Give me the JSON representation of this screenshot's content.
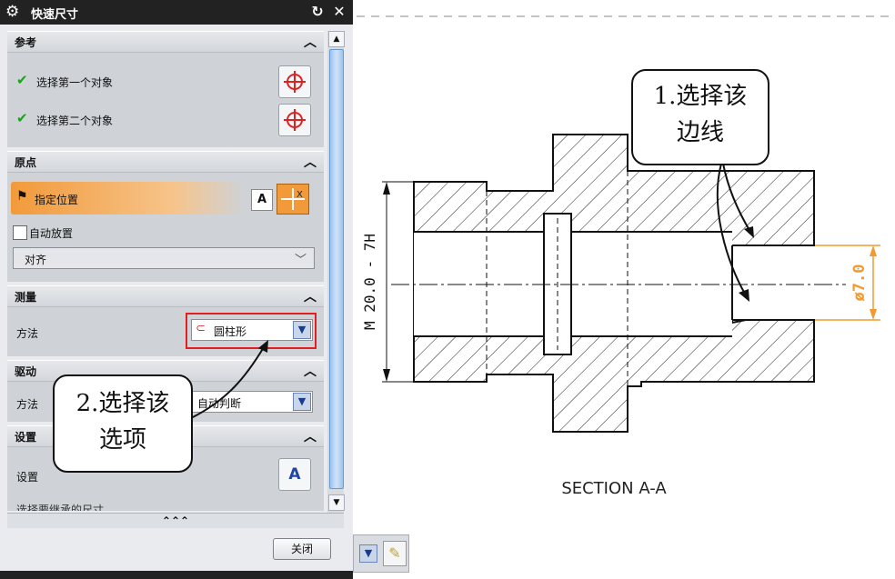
{
  "window": {
    "title": "快速尺寸"
  },
  "sections": {
    "reference": {
      "label": "参考",
      "item1": "选择第一个对象",
      "item2": "选择第二个对象"
    },
    "origin": {
      "label": "原点",
      "specify": "指定位置",
      "auto_place": "自动放置",
      "align": "对齐"
    },
    "measure": {
      "label": "测量",
      "method_label": "方法",
      "method_value": "圆柱形"
    },
    "driving": {
      "label": "驱动",
      "method_label": "方法",
      "method_value": "自动判断"
    },
    "settings": {
      "label": "设置",
      "settings_label": "设置",
      "partial": "选择要继承的尺寸"
    }
  },
  "more_label": "⌃⌃⌃",
  "close_label": "关闭",
  "callouts": {
    "c1_line1": "1.选择该",
    "c1_line2": "边线",
    "c2_line1": "2.选择该",
    "c2_line2": "选项"
  },
  "drawing": {
    "section_label": "SECTION A-A",
    "dim_left": "M 20.0 - 7H",
    "dim_right": "ø7.0"
  },
  "colors": {
    "accent_orange": "#f29a3a",
    "highlight_red": "#e02020",
    "dimension_orange": "#f39a2e"
  }
}
